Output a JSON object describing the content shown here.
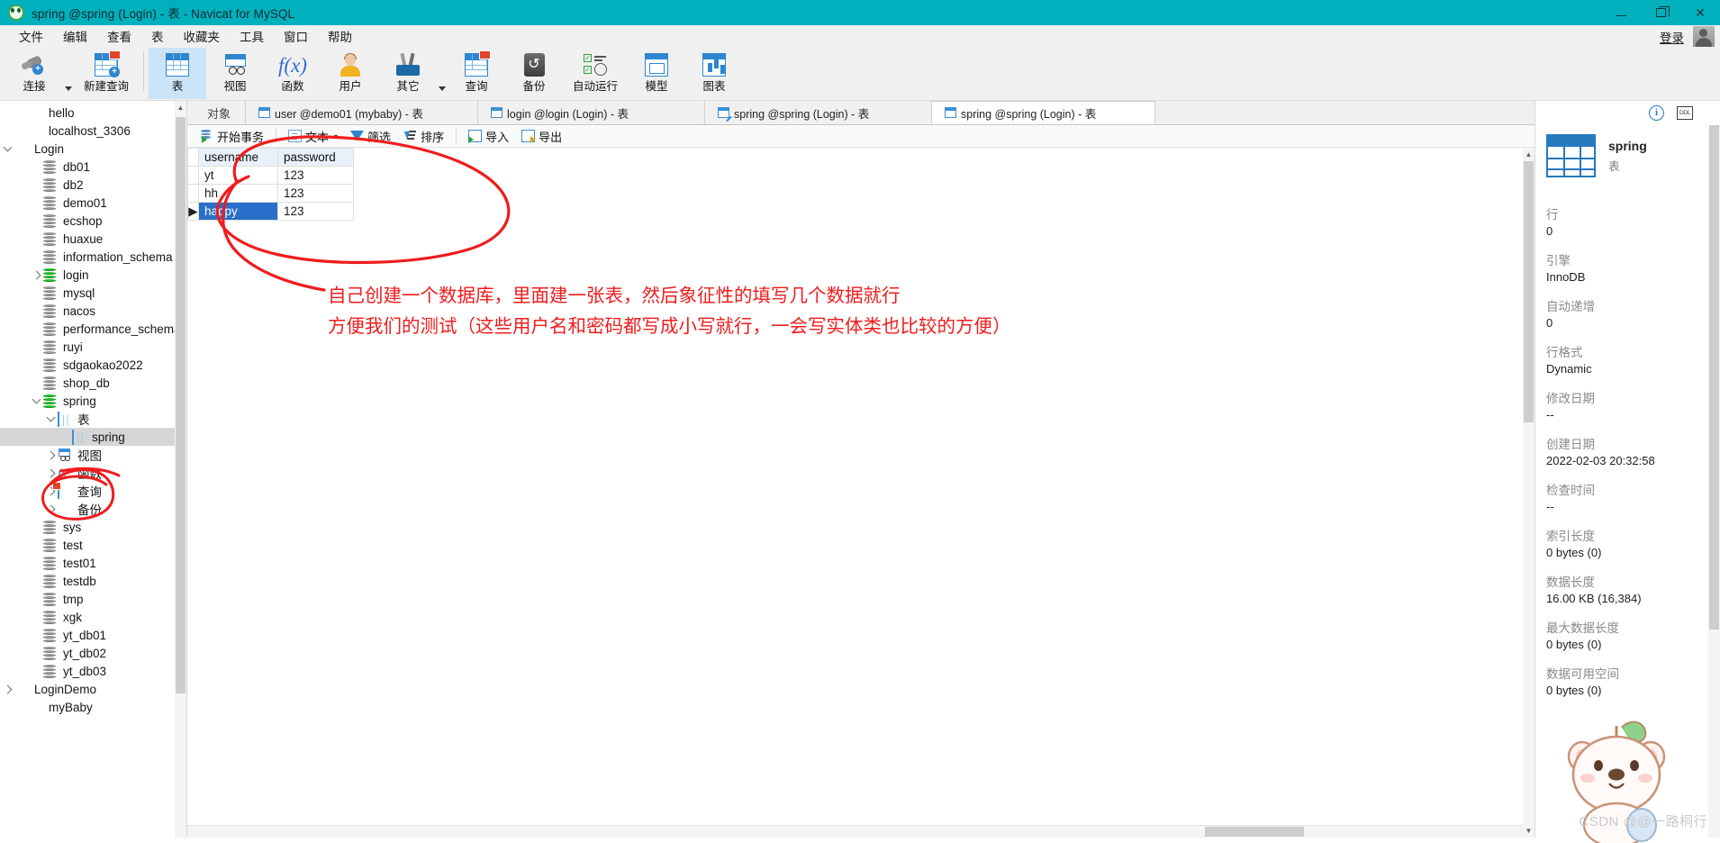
{
  "window": {
    "title": "spring @spring (Login) - 表 - Navicat for MySQL",
    "app_icon": "navicat-logo-icon",
    "minimize": "–",
    "maximize": "❐",
    "close": "✕"
  },
  "menubar": {
    "items": [
      "文件",
      "编辑",
      "查看",
      "表",
      "收藏夹",
      "工具",
      "窗口",
      "帮助"
    ],
    "login_label": "登录"
  },
  "toolbar": {
    "buttons": [
      {
        "label": "连接",
        "icon": "connection-plug-icon",
        "has_caret": true
      },
      {
        "label": "新建查询",
        "icon": "new-query-icon",
        "has_caret": false
      },
      {
        "label": "表",
        "icon": "table-icon",
        "has_caret": false,
        "active": true
      },
      {
        "label": "视图",
        "icon": "view-icon",
        "has_caret": false
      },
      {
        "label": "函数",
        "icon": "function-fx-icon",
        "has_caret": false
      },
      {
        "label": "用户",
        "icon": "user-icon",
        "has_caret": false
      },
      {
        "label": "其它",
        "icon": "other-tools-icon",
        "has_caret": true
      },
      {
        "label": "查询",
        "icon": "query-icon",
        "has_caret": false
      },
      {
        "label": "备份",
        "icon": "backup-icon",
        "has_caret": false
      },
      {
        "label": "自动运行",
        "icon": "automation-icon",
        "has_caret": false
      },
      {
        "label": "模型",
        "icon": "model-icon",
        "has_caret": false
      },
      {
        "label": "图表",
        "icon": "chart-icon",
        "has_caret": false
      }
    ]
  },
  "sidebar": {
    "tree": [
      {
        "label": "hello",
        "icon": "connection-icon",
        "indent": 1,
        "twisty": "",
        "selected": false
      },
      {
        "label": "localhost_3306",
        "icon": "connection-icon",
        "indent": 1,
        "twisty": "",
        "selected": false
      },
      {
        "label": "Login",
        "icon": "connection-green-icon",
        "indent": 0,
        "twisty": "down",
        "selected": false
      },
      {
        "label": "db01",
        "icon": "database-icon",
        "indent": 2,
        "twisty": "",
        "selected": false
      },
      {
        "label": "db2",
        "icon": "database-icon",
        "indent": 2,
        "twisty": "",
        "selected": false
      },
      {
        "label": "demo01",
        "icon": "database-icon",
        "indent": 2,
        "twisty": "",
        "selected": false
      },
      {
        "label": "ecshop",
        "icon": "database-icon",
        "indent": 2,
        "twisty": "",
        "selected": false
      },
      {
        "label": "huaxue",
        "icon": "database-icon",
        "indent": 2,
        "twisty": "",
        "selected": false
      },
      {
        "label": "information_schema",
        "icon": "database-icon",
        "indent": 2,
        "twisty": "",
        "selected": false
      },
      {
        "label": "login",
        "icon": "database-green-icon",
        "indent": 2,
        "twisty": "right",
        "selected": false
      },
      {
        "label": "mysql",
        "icon": "database-icon",
        "indent": 2,
        "twisty": "",
        "selected": false
      },
      {
        "label": "nacos",
        "icon": "database-icon",
        "indent": 2,
        "twisty": "",
        "selected": false
      },
      {
        "label": "performance_schema",
        "icon": "database-icon",
        "indent": 2,
        "twisty": "",
        "selected": false
      },
      {
        "label": "ruyi",
        "icon": "database-icon",
        "indent": 2,
        "twisty": "",
        "selected": false
      },
      {
        "label": "sdgaokao2022",
        "icon": "database-icon",
        "indent": 2,
        "twisty": "",
        "selected": false
      },
      {
        "label": "shop_db",
        "icon": "database-icon",
        "indent": 2,
        "twisty": "",
        "selected": false
      },
      {
        "label": "spring",
        "icon": "database-green-icon",
        "indent": 2,
        "twisty": "down",
        "selected": false
      },
      {
        "label": "表",
        "icon": "table-folder-icon",
        "indent": 3,
        "twisty": "down",
        "selected": false
      },
      {
        "label": "spring",
        "icon": "table-folder-icon",
        "indent": 4,
        "twisty": "",
        "selected": true
      },
      {
        "label": "视图",
        "icon": "view-folder-icon",
        "indent": 3,
        "twisty": "right",
        "selected": false
      },
      {
        "label": "函数",
        "icon": "function-folder-icon",
        "indent": 3,
        "twisty": "right",
        "selected": false
      },
      {
        "label": "查询",
        "icon": "query-folder-icon",
        "indent": 3,
        "twisty": "right",
        "selected": false
      },
      {
        "label": "备份",
        "icon": "backup-folder-icon",
        "indent": 3,
        "twisty": "right",
        "selected": false
      },
      {
        "label": "sys",
        "icon": "database-icon",
        "indent": 2,
        "twisty": "",
        "selected": false
      },
      {
        "label": "test",
        "icon": "database-icon",
        "indent": 2,
        "twisty": "",
        "selected": false
      },
      {
        "label": "test01",
        "icon": "database-icon",
        "indent": 2,
        "twisty": "",
        "selected": false
      },
      {
        "label": "testdb",
        "icon": "database-icon",
        "indent": 2,
        "twisty": "",
        "selected": false
      },
      {
        "label": "tmp",
        "icon": "database-icon",
        "indent": 2,
        "twisty": "",
        "selected": false
      },
      {
        "label": "xgk",
        "icon": "database-icon",
        "indent": 2,
        "twisty": "",
        "selected": false
      },
      {
        "label": "yt_db01",
        "icon": "database-icon",
        "indent": 2,
        "twisty": "",
        "selected": false
      },
      {
        "label": "yt_db02",
        "icon": "database-icon",
        "indent": 2,
        "twisty": "",
        "selected": false
      },
      {
        "label": "yt_db03",
        "icon": "database-icon",
        "indent": 2,
        "twisty": "",
        "selected": false
      },
      {
        "label": "LoginDemo",
        "icon": "connection-green-icon",
        "indent": 0,
        "twisty": "right",
        "selected": false
      },
      {
        "label": "myBaby",
        "icon": "connection-icon",
        "indent": 1,
        "twisty": "",
        "selected": false
      }
    ]
  },
  "objectbar": {
    "label": "对象",
    "tabs": [
      {
        "title": "user @demo01 (mybaby) - 表",
        "icon": "table-tab-icon",
        "active": false
      },
      {
        "title": "login @login (Login) - 表",
        "icon": "table-tab-icon",
        "active": false
      },
      {
        "title": "spring @spring (Login) - 表",
        "icon": "table-design-tab-icon",
        "active": false
      },
      {
        "title": "spring @spring (Login) - 表",
        "icon": "table-tab-icon",
        "active": true
      }
    ]
  },
  "gridtoolbar": {
    "buttons": [
      {
        "label": "开始事务",
        "icon": "begin-transaction-icon",
        "caret": false
      },
      {
        "label": "文本",
        "icon": "text-icon",
        "caret": true
      },
      {
        "label": "筛选",
        "icon": "filter-icon",
        "caret": false
      },
      {
        "label": "排序",
        "icon": "sort-icon",
        "caret": false
      },
      {
        "label": "导入",
        "icon": "import-icon",
        "caret": false
      },
      {
        "label": "导出",
        "icon": "export-icon",
        "caret": false
      }
    ]
  },
  "datagrid": {
    "columns": [
      "username",
      "password"
    ],
    "rows": [
      {
        "username": "yt",
        "password": "123",
        "selected": false,
        "marker": ""
      },
      {
        "username": "hh",
        "password": "123",
        "selected": false,
        "marker": ""
      },
      {
        "username": "happy",
        "password": "123",
        "selected": true,
        "marker": "▶"
      }
    ]
  },
  "infopanel": {
    "header_icons": [
      "info-icon",
      "ddl-icon"
    ],
    "object_name": "spring",
    "object_type": "表",
    "properties": [
      {
        "key": "行",
        "value": "0"
      },
      {
        "key": "引擎",
        "value": "InnoDB"
      },
      {
        "key": "自动递增",
        "value": "0"
      },
      {
        "key": "行格式",
        "value": "Dynamic"
      },
      {
        "key": "修改日期",
        "value": "--"
      },
      {
        "key": "创建日期",
        "value": "2022-02-03 20:32:58"
      },
      {
        "key": "检查时间",
        "value": "--"
      },
      {
        "key": "索引长度",
        "value": "0 bytes (0)"
      },
      {
        "key": "数据长度",
        "value": "16.00 KB (16,384)"
      },
      {
        "key": "最大数据长度",
        "value": "0 bytes (0)"
      },
      {
        "key": "数据可用空间",
        "value": "0 bytes (0)"
      }
    ]
  },
  "annotations": {
    "line1": "自己创建一个数据库，里面建一张表，然后象征性的填写几个数据就行",
    "line2": "方便我们的测试（这些用户名和密码都写成小写就行，一会写实体类也比较的方便）",
    "ink_color": "#f01c1c"
  },
  "watermark": {
    "text": "CSDN @@一路桐行"
  }
}
